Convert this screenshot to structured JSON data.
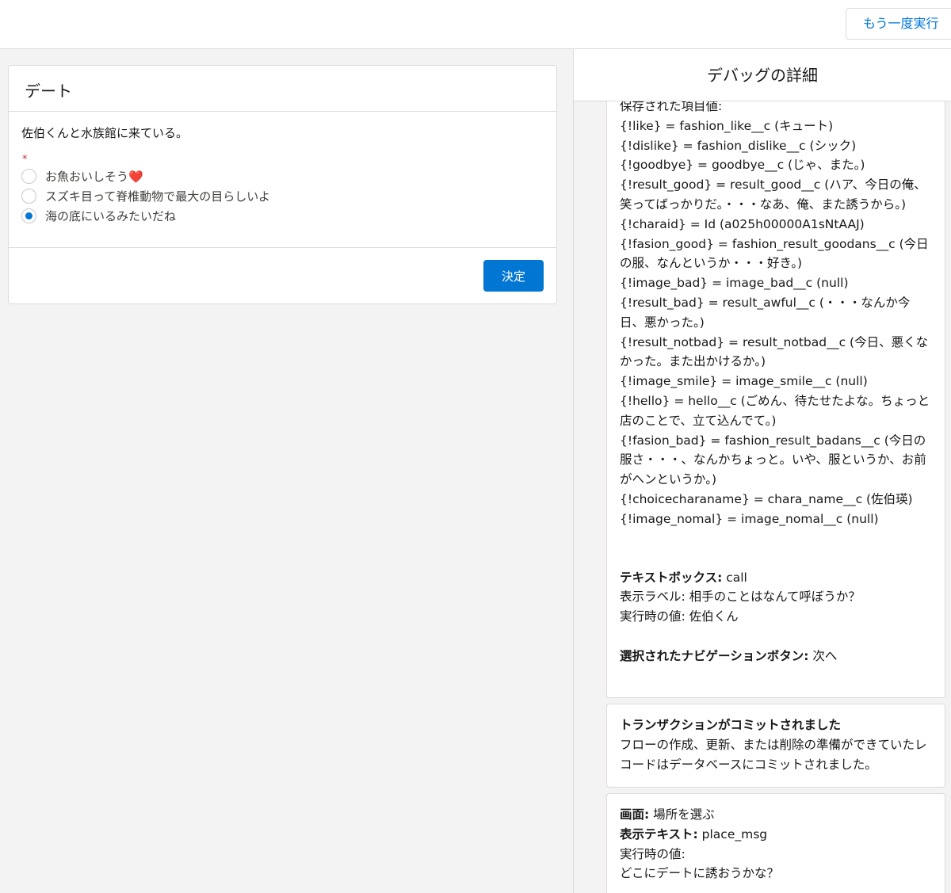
{
  "header": {
    "rerun_label": "もう一度実行"
  },
  "screen": {
    "title": "デート",
    "question": "佐伯くんと水族館に来ている。",
    "required_mark": "*",
    "options": [
      {
        "label": "お魚おいしそう",
        "emoji": "❤️",
        "selected": false
      },
      {
        "label": "スズキ目って脊椎動物で最大の目らしいよ",
        "emoji": "",
        "selected": false
      },
      {
        "label": "海の底にいるみたいだね",
        "emoji": "",
        "selected": true
      }
    ],
    "submit_label": "決定"
  },
  "debug": {
    "title": "デバッグの詳細",
    "card1": {
      "saved_values_label": "保存された項目値:",
      "lines": [
        "{!like} = fashion_like__c (キュート)",
        "{!dislike} = fashion_dislike__c (シック)",
        "{!goodbye} = goodbye__c (じゃ、また。)",
        "{!result_good} = result_good__c (ハア、今日の俺、笑ってばっかりだ。・・・なあ、俺、また誘うから。)",
        "{!charaid} = Id (a025h00000A1sNtAAJ)",
        "{!fasion_good} = fashion_result_goodans__c (今日の服、なんというか・・・好き。)",
        "{!image_bad} = image_bad__c (null)",
        "{!result_bad} = result_awful__c (・・・なんか今日、悪かった。)",
        "{!result_notbad} = result_notbad__c (今日、悪くなかった。また出かけるか。)",
        "{!image_smile} = image_smile__c (null)",
        "{!hello} = hello__c (ごめん、待たせたよな。ちょっと店のことで、立て込んでて。)",
        "{!fasion_bad} = fashion_result_badans__c (今日の服さ・・・、なんかちょっと。いや、服というか、お前がヘンというか。)",
        "{!choicecharaname} = chara_name__c (佐伯瑛)",
        "{!image_nomal} = image_nomal__c (null)"
      ],
      "textbox_label": "テキストボックス:",
      "textbox_value": " call",
      "display_label_line": "表示ラベル: 相手のことはなんて呼ぼうか？",
      "runtime_value_line": "実行時の値: 佐伯くん",
      "nav_label": "選択されたナビゲーションボタン:",
      "nav_value": " 次へ"
    },
    "card2": {
      "title": "トランザクションがコミットされました",
      "body": "フローの作成、更新、または削除の準備ができていたレコードはデータベースにコミットされました。"
    },
    "card3": {
      "screen_label": "画面:",
      "screen_value": " 場所を選ぶ",
      "display_text_label": "表示テキスト:",
      "display_text_value": " place_msg",
      "runtime_label": "実行時の値:",
      "runtime_value": "どこにデートに誘おうかな？"
    }
  }
}
